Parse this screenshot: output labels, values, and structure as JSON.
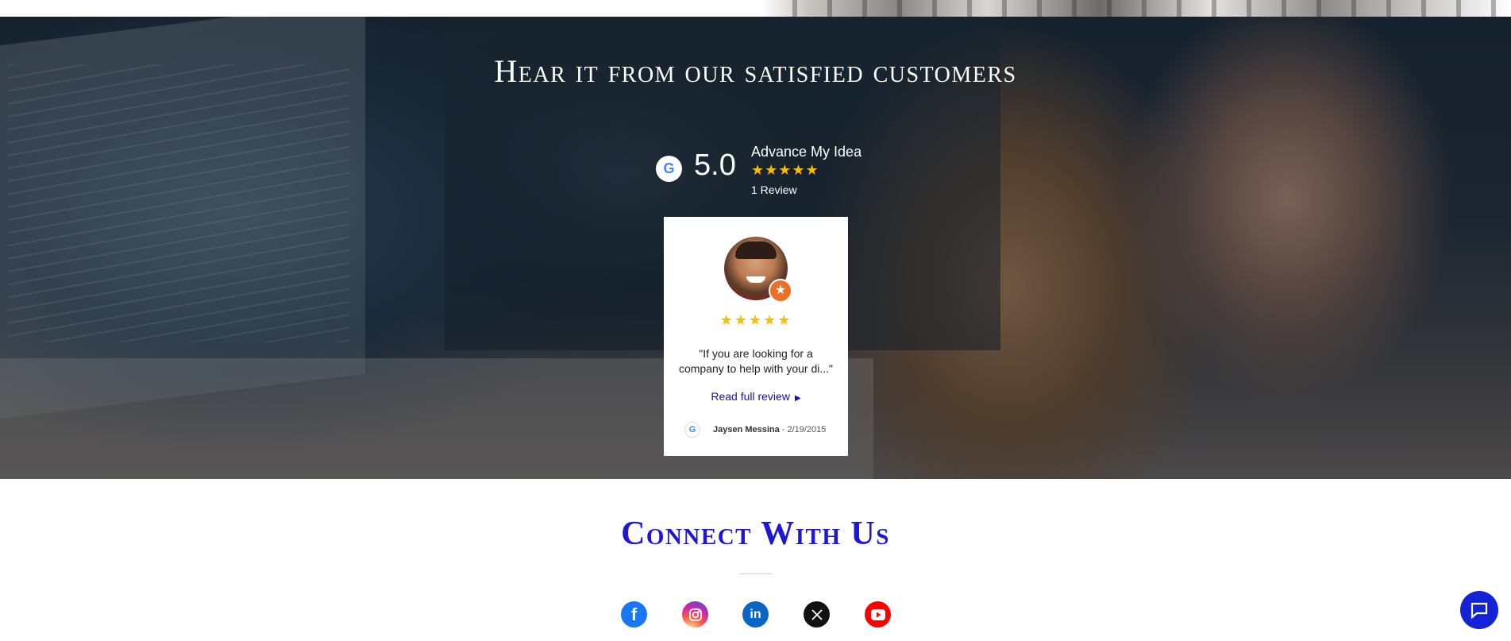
{
  "hero": {
    "title": "Hear it from our satisfied customers"
  },
  "rating": {
    "provider_icon": "google-g-icon",
    "score": "5.0",
    "business_name": "Advance My Idea",
    "stars": "★★★★★",
    "review_count": "1 Review"
  },
  "review": {
    "stars": "★★★★★",
    "quote": "\"If you are looking for a company to help with your di...\"",
    "read_more": "Read full review",
    "reviewer": "Jaysen Messina",
    "date_sep": " - ",
    "date": "2/19/2015",
    "badge_icon": "local-guide-star-icon"
  },
  "connect": {
    "title": "Connect With Us",
    "socials": [
      {
        "name": "facebook",
        "icon": "facebook-icon",
        "color": "#1877f2"
      },
      {
        "name": "instagram",
        "icon": "instagram-icon",
        "color": "#d6249f"
      },
      {
        "name": "linkedin",
        "icon": "linkedin-icon",
        "color": "#0a66c2"
      },
      {
        "name": "x",
        "icon": "x-icon",
        "color": "#111111"
      },
      {
        "name": "youtube",
        "icon": "youtube-icon",
        "color": "#ff0000"
      }
    ]
  },
  "chat": {
    "icon": "chat-bubble-icon",
    "color": "#1523d6"
  },
  "colors": {
    "accent_blue": "#1e18d6",
    "star_yellow": "#fbbc04",
    "link_blue": "#1a0dab"
  }
}
